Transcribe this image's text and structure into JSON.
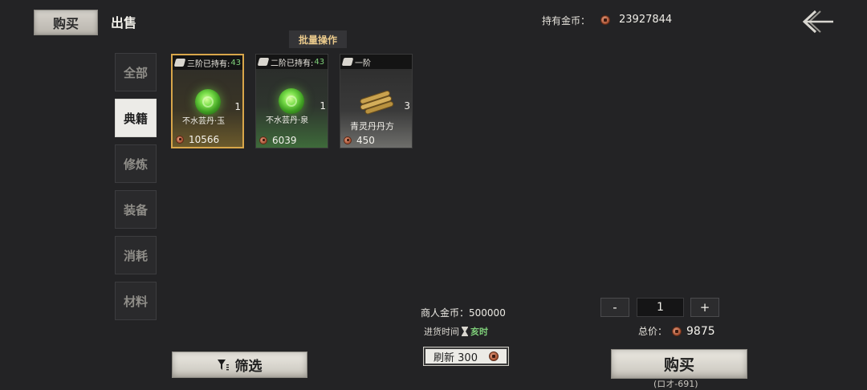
{
  "top_tabs": {
    "buy_label": "购买",
    "sell_label": "出售"
  },
  "wallet": {
    "label": "持有金币：",
    "amount": "23927844"
  },
  "batch_label": "批量操作",
  "categories": [
    {
      "label": "全部",
      "active": false
    },
    {
      "label": "典籍",
      "active": true
    },
    {
      "label": "修炼",
      "active": false
    },
    {
      "label": "装备",
      "active": false
    },
    {
      "label": "消耗",
      "active": false
    },
    {
      "label": "材料",
      "active": false
    }
  ],
  "items": [
    {
      "tier": "三阶",
      "owned_label": "已持有:",
      "owned": "43",
      "name": "不水芸丹·玉",
      "count": "1",
      "price": "10566",
      "rarity": "gold",
      "image": "green-pill"
    },
    {
      "tier": "二阶",
      "owned_label": "已持有:",
      "owned": "43",
      "name": "不水芸丹·泉",
      "count": "1",
      "price": "6039",
      "rarity": "green",
      "image": "green-pill"
    },
    {
      "tier": "一阶",
      "owned_label": "",
      "owned": "",
      "name": "青灵丹丹方",
      "count": "3",
      "price": "450",
      "rarity": "white",
      "image": "bamboo-scrolls"
    }
  ],
  "filter_label": "筛选",
  "merchant": {
    "coins_label": "商人金币：",
    "coins": "500000",
    "restock_label": "进货时间",
    "restock_time": "亥时",
    "refresh_label": "刷新",
    "refresh_cost": "300"
  },
  "purchase": {
    "minus": "-",
    "plus": "+",
    "quantity": "1",
    "total_label": "总价：",
    "total": "9875",
    "buy_label": "购买",
    "sub_text": "(ロオ-691)"
  },
  "colors": {
    "background": "#232325",
    "accent_gold": "#d8a64a",
    "owned_green": "#7fd07a",
    "batch_text": "#e9c98b"
  }
}
